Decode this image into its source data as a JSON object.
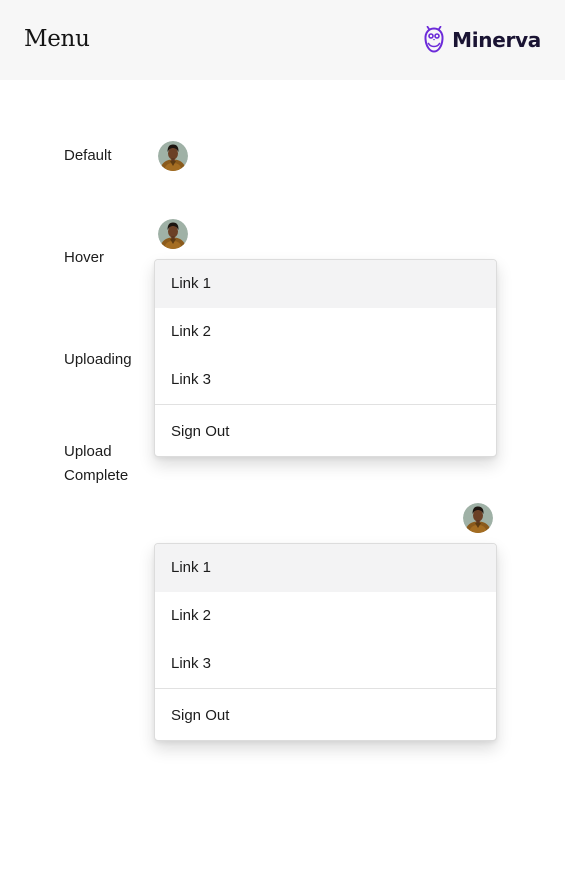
{
  "header": {
    "title": "Menu",
    "brand_name": "Minerva",
    "brand_icon": "owl-icon",
    "brand_color": "#6c2bd9"
  },
  "states": {
    "default": "Default",
    "hover": "Hover",
    "uploading": "Uploading",
    "upload_complete_line1": "Upload",
    "upload_complete_line2": "Complete"
  },
  "menus": [
    {
      "items": [
        "Link 1",
        "Link 2",
        "Link 3"
      ],
      "sign_out": "Sign Out",
      "hovered_item": "Link 1"
    },
    {
      "items": [
        "Link 1",
        "Link 2",
        "Link 3"
      ],
      "sign_out": "Sign Out",
      "hovered_item": "Link 1"
    }
  ]
}
